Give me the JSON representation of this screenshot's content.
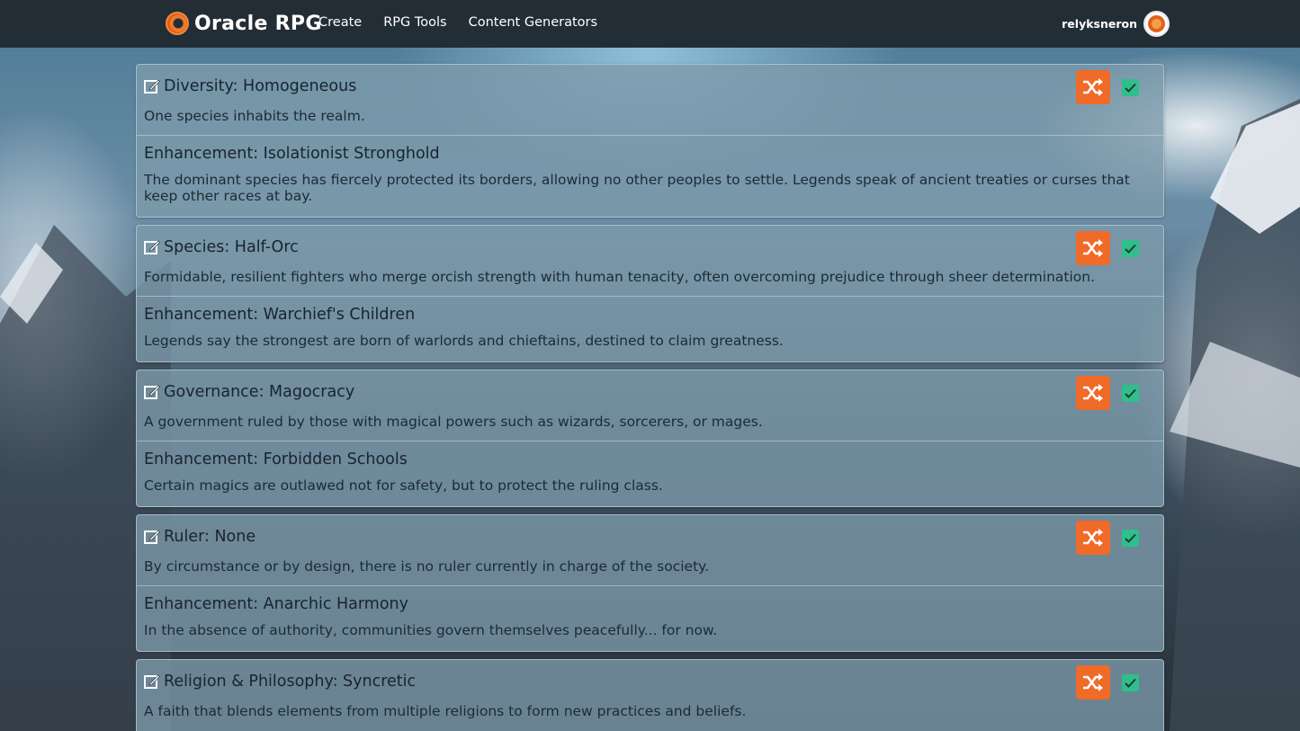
{
  "app": {
    "brand": "Oracle RPG",
    "nav": [
      "Create",
      "RPG Tools",
      "Content Generators"
    ],
    "username": "relyksneron"
  },
  "colors": {
    "header_bg": "#222d36",
    "accent": "#f06a28",
    "checkbox": "#2fbf8a",
    "card_bg": "#7d9bac"
  },
  "icons": [
    "edit-icon",
    "shuffle-icon",
    "checkbox-checked-icon"
  ],
  "cards": [
    {
      "title": "Diversity: Homogeneous",
      "description": "One species inhabits the realm.",
      "enhancement_title": "Enhancement: Isolationist Stronghold",
      "enhancement_description": "The dominant species has fiercely protected its borders, allowing no other peoples to settle. Legends speak of ancient treaties or curses that keep other races at bay.",
      "checked": true
    },
    {
      "title": "Species: Half-Orc",
      "description": "Formidable, resilient fighters who merge orcish strength with human tenacity, often overcoming prejudice through sheer determination.",
      "enhancement_title": "Enhancement: Warchief's Children",
      "enhancement_description": "Legends say the strongest are born of warlords and chieftains, destined to claim greatness.",
      "checked": true
    },
    {
      "title": "Governance: Magocracy",
      "description": "A government ruled by those with magical powers such as wizards, sorcerers, or mages.",
      "enhancement_title": "Enhancement: Forbidden Schools",
      "enhancement_description": "Certain magics are outlawed not for safety, but to protect the ruling class.",
      "checked": true
    },
    {
      "title": "Ruler: None",
      "description": "By circumstance or by design, there is no ruler currently in charge of the society.",
      "enhancement_title": "Enhancement: Anarchic Harmony",
      "enhancement_description": "In the absence of authority, communities govern themselves peacefully... for now.",
      "checked": true
    },
    {
      "title": "Religion & Philosophy: Syncretic",
      "description": "A faith that blends elements from multiple religions to form new practices and beliefs.",
      "checked": true
    }
  ]
}
